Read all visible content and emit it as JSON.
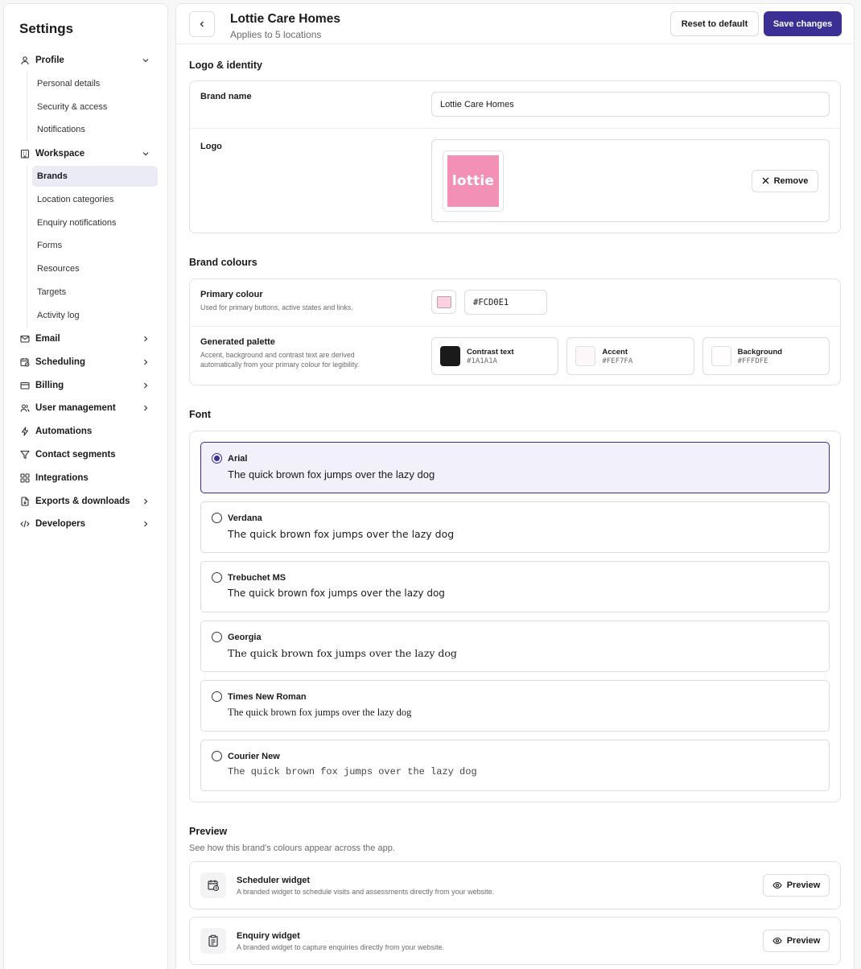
{
  "sidebar": {
    "title": "Settings",
    "profile": {
      "label": "Profile",
      "items": [
        "Personal details",
        "Security & access",
        "Notifications"
      ]
    },
    "workspace": {
      "label": "Workspace",
      "items": [
        "Brands",
        "Location categories",
        "Enquiry notifications",
        "Forms",
        "Resources",
        "Targets",
        "Activity log"
      ]
    },
    "other": [
      "Email",
      "Scheduling",
      "Billing",
      "User management",
      "Automations",
      "Contact segments",
      "Integrations",
      "Exports & downloads",
      "Developers"
    ]
  },
  "header": {
    "title": "Lottie Care Homes",
    "subtitle": "Applies to 5 locations",
    "reset_label": "Reset to default",
    "save_label": "Save changes"
  },
  "logo_identity": {
    "title": "Logo & identity",
    "brand_name_label": "Brand name",
    "brand_name_value": "Lottie Care Homes",
    "logo_label": "Logo",
    "logo_text": "lottie",
    "remove_label": "Remove"
  },
  "colours": {
    "title": "Brand colours",
    "primary_label": "Primary colour",
    "primary_desc": "Used for primary buttons, active states and links.",
    "primary_hex": "#FCD0E1",
    "palette_label": "Generated palette",
    "palette_desc": "Accent, background and contrast text are derived automatically from your primary colour for legibility.",
    "palette": [
      {
        "name": "Contrast text",
        "hex": "#1A1A1A"
      },
      {
        "name": "Accent",
        "hex": "#FEF7FA"
      },
      {
        "name": "Background",
        "hex": "#FFFDFE"
      }
    ]
  },
  "font": {
    "title": "Font",
    "sample": "The quick brown fox jumps over the lazy dog",
    "options": [
      "Arial",
      "Verdana",
      "Trebuchet MS",
      "Georgia",
      "Times New Roman",
      "Courier New"
    ],
    "selected": "Arial"
  },
  "preview": {
    "title": "Preview",
    "desc": "See how this brand's colours appear across the app.",
    "widgets": [
      {
        "title": "Scheduler widget",
        "desc": "A branded widget to schedule visits and assessments directly from your website.",
        "button": "Preview"
      },
      {
        "title": "Enquiry widget",
        "desc": "A branded widget to capture enquiries directly from your website.",
        "button": "Preview"
      }
    ]
  },
  "theme": {
    "accent": "#3B2F96",
    "primary": "#FCD0E1",
    "logo_bg": "#F390B6"
  }
}
